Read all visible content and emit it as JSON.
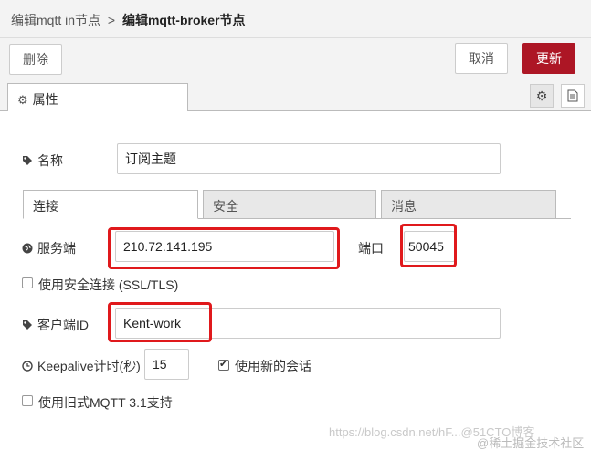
{
  "breadcrumb": {
    "parent": "编辑mqtt in节点",
    "separator": ">",
    "current": "编辑mqtt-broker节点"
  },
  "toolbar": {
    "delete_label": "删除",
    "cancel_label": "取消",
    "update_label": "更新"
  },
  "tabs": {
    "properties_label": "属性"
  },
  "form": {
    "name": {
      "label": "名称",
      "value": "订阅主题"
    },
    "subtabs": [
      {
        "label": "连接",
        "active": true
      },
      {
        "label": "安全",
        "active": false
      },
      {
        "label": "消息",
        "active": false
      }
    ],
    "server": {
      "label": "服务端",
      "value": "210.72.141.195"
    },
    "port": {
      "label": "端口",
      "value": "50045"
    },
    "tls": {
      "label": "使用安全连接 (SSL/TLS)",
      "checked": false
    },
    "client_id": {
      "label": "客户端ID",
      "value": "Kent-work"
    },
    "keepalive": {
      "label": "Keepalive计时(秒)",
      "value": "15"
    },
    "clean_session": {
      "label": "使用新的会话",
      "checked": true
    },
    "legacy": {
      "label": "使用旧式MQTT 3.1支持",
      "checked": false
    }
  },
  "watermark": {
    "line1": "https://blog.csdn.net/hF...@51CTO博客",
    "line2": "@稀土掘金技术社区"
  },
  "colors": {
    "accent": "#ad1625",
    "highlight": "#e0191c"
  }
}
